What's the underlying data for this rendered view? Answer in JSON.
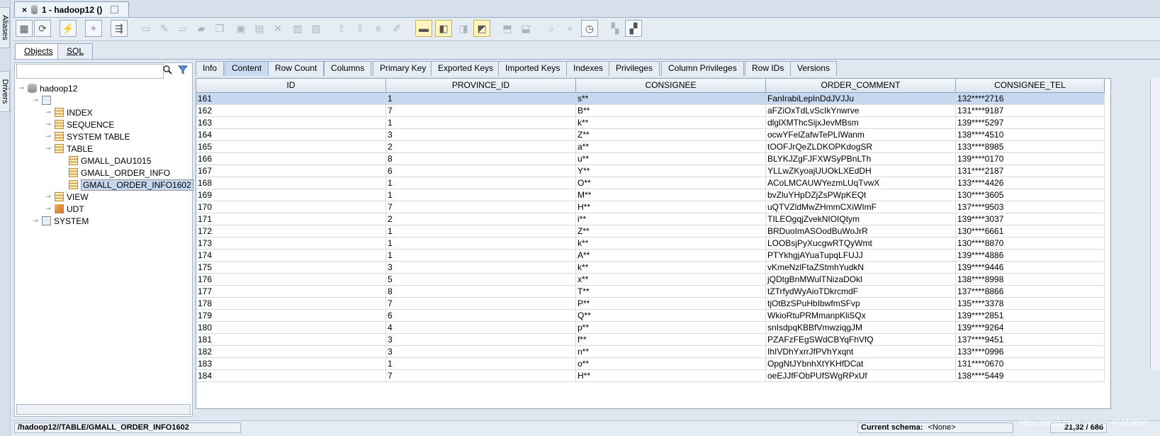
{
  "side_tabs": {
    "aliases": "Aliases",
    "drivers": "Drivers"
  },
  "doc_tab": {
    "close": "×",
    "title": "1 - hadoop12 ()"
  },
  "obj_tabs": [
    "Objects",
    "SQL"
  ],
  "filter": {
    "value": ""
  },
  "tree": {
    "root": "hadoop12",
    "schema": "",
    "items": [
      "INDEX",
      "SEQUENCE",
      "SYSTEM TABLE",
      "TABLE",
      "VIEW",
      "UDT"
    ],
    "tables": [
      "GMALL_DAU1015",
      "GMALL_ORDER_INFO",
      "GMALL_ORDER_INFO1602"
    ],
    "system": "SYSTEM"
  },
  "detail_tabs": [
    "Info",
    "Content",
    "Row Count",
    "Columns",
    "Primary Key",
    "Exported Keys",
    "Imported Keys",
    "Indexes",
    "Privileges",
    "Column Privileges",
    "Row IDs",
    "Versions"
  ],
  "grid": {
    "columns": [
      "ID",
      "PROVINCE_ID",
      "CONSIGNEE",
      "ORDER_COMMENT",
      "CONSIGNEE_TEL"
    ],
    "rows": [
      [
        "161",
        "1",
        "s**",
        "FanIrabiLepInDdJVJJu",
        "132****2716"
      ],
      [
        "162",
        "7",
        "B**",
        "aFZiOxTdLvScIkYnwrve",
        "131****9187"
      ],
      [
        "163",
        "1",
        "k**",
        "dlglXMThcSijxJevMBsm",
        "139****5297"
      ],
      [
        "164",
        "3",
        "Z**",
        "ocwYFelZafwTePLIWanm",
        "138****4510"
      ],
      [
        "165",
        "2",
        "a**",
        "tOOFJrQeZLDKOPKdogSR",
        "133****8985"
      ],
      [
        "166",
        "8",
        "u**",
        "BLYKJZgFJFXWSyPBnLTh",
        "139****0170"
      ],
      [
        "167",
        "6",
        "Y**",
        "YLLwZKyoajUUOkLXEdDH",
        "131****2187"
      ],
      [
        "168",
        "1",
        "O**",
        "ACoLMCAUWYezmLUqTvwX",
        "133****4426"
      ],
      [
        "169",
        "1",
        "M**",
        "bvZluYHpDZjZsPWpKEQt",
        "130****3605"
      ],
      [
        "170",
        "7",
        "H**",
        "uQTVZldMwZHmmCXiWImF",
        "137****9503"
      ],
      [
        "171",
        "2",
        "i**",
        "TILEOgqjZvekNIOIQtym",
        "139****3037"
      ],
      [
        "172",
        "1",
        "Z**",
        "BRDuoImASOodBuWoJrR",
        "130****6661"
      ],
      [
        "173",
        "1",
        "k**",
        "LOOBsjPyXucgwRTQyWmt",
        "130****8870"
      ],
      [
        "174",
        "1",
        "A**",
        "PTYkhgjAYuaTupqLFUJJ",
        "139****4886"
      ],
      [
        "175",
        "3",
        "k**",
        "vKmeNzlFtaZStmhYudkN",
        "139****9446"
      ],
      [
        "176",
        "5",
        "x**",
        "jQDtgBnMWulTNizaDOkl",
        "138****8998"
      ],
      [
        "177",
        "8",
        "T**",
        "tZTrfydWyAioTDkrcmdF",
        "137****8866"
      ],
      [
        "178",
        "7",
        "P**",
        "tjOtBzSPuHbIbwfmSFvp",
        "135****3378"
      ],
      [
        "179",
        "6",
        "Q**",
        "WkioRtuPRMmanpKliSQx",
        "139****2851"
      ],
      [
        "180",
        "4",
        "p**",
        "snIsdpqKBBfVmwziqgJM",
        "139****9264"
      ],
      [
        "181",
        "3",
        "f**",
        "PZAFzFEgSWdCBYqFhVfQ",
        "137****9451"
      ],
      [
        "182",
        "3",
        "n**",
        "IhIVDhYxrrJfPVhYxqnt",
        "133****0996"
      ],
      [
        "183",
        "1",
        "o**",
        "OpgNtJYbnhXtYKHfDCat",
        "131****0670"
      ],
      [
        "184",
        "7",
        "H**",
        "oeEJJfFObPUfSWgRPxUf",
        "138****5449"
      ]
    ]
  },
  "status": {
    "path": "/hadoop12//TABLE/GMALL_ORDER_INFO1602",
    "schema_label": "Current schema:",
    "schema_value": "<None>",
    "position": "21,32 / 686",
    "watermark": "https://blog.csdn.net/qq_45118858"
  },
  "colors": {
    "selection": "#c5d8ef",
    "accent": "#c9dbf0"
  }
}
